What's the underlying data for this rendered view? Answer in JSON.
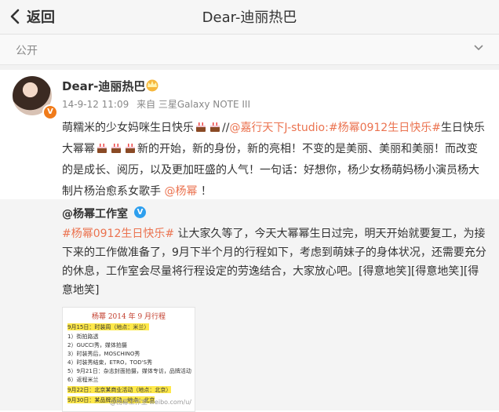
{
  "header": {
    "back_label": "返回",
    "title": "Dear-迪丽热巴"
  },
  "visibility": {
    "label": "公开"
  },
  "post": {
    "username": "Dear-迪丽热巴",
    "timestamp": "14-9-12 11:09",
    "source": "来自 三星Galaxy NOTE III",
    "text_parts": {
      "p1": "萌糯米的少女妈咪生日快乐",
      "p2": "//",
      "mention1": "@嘉行天下J-studio",
      "colon": ":",
      "hashtag": "#杨幂0912生日快乐#",
      "p3": "生日快乐大幂幂",
      "p4": "新的开始，新的身份，新的亮相！不变的是美丽、美丽和美丽！而改变的是成长、阅历，以及更加旺盛的人气！一句话：好想你，杨少女杨萌妈杨小演员杨大制片杨治愈系女歌手 ",
      "mention2": "@杨幂",
      "p5": " ！"
    }
  },
  "repost": {
    "username": "@杨幂工作室",
    "hashtag": "#杨幂0912生日快乐#",
    "text": " 让大家久等了，今天大幂幂生日过完，明天开始就要复工，为接下来的工作做准备了，9月下半个月的行程如下，考虑到萌妹子的身体状况，还需要充分的休息，工作室会尽量将行程设定的劳逸结合，大家放心吧。[得意地笑][得意地笑][得意地笑]",
    "image": {
      "title": "杨幂 2014 年 9 月行程",
      "lines": [
        "9月15日：时装周（地点：米兰）",
        "1）街拍路透",
        "2）GUCCI秀，媒体拍摄",
        "3）时装秀后，MOSCHINO秀",
        "4）时装秀结束，ETRO，TOD'S秀",
        "5）9月21日：杂志封面拍摄，媒体专访，品牌活动",
        "6）返程米兰",
        "9月22日：北京某商业活动（地点：北京）",
        "9月30日：某品牌活动，地点：北京"
      ],
      "watermark": "@杨幂工作室 weibo.com/u/"
    }
  },
  "colors": {
    "link": "#eb7350",
    "verified_orange": "#f07b1a",
    "verified_blue": "#2e9fee"
  }
}
